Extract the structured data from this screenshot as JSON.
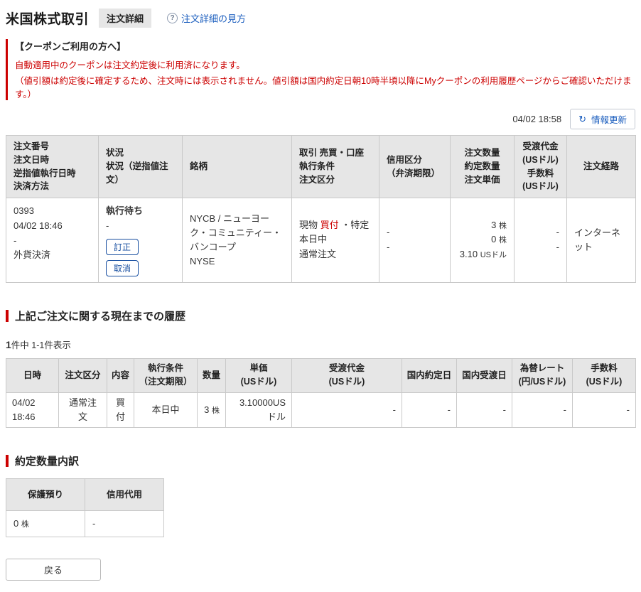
{
  "page": {
    "title": "米国株式取引",
    "badge": "注文詳細",
    "help_link": "注文詳細の見方"
  },
  "icons": {
    "help": "?",
    "refresh": "↻"
  },
  "coupon_notice": {
    "heading": "【クーポンご利用の方へ】",
    "line1": "自動適用中のクーポンは注文約定後に利用済になります。",
    "line2": "（値引額は約定後に確定するため、注文時には表示されません。値引額は国内約定日朝10時半頃以降にMyクーポンの利用履歴ページからご確認いただけます。）"
  },
  "toolbar": {
    "timestamp": "04/02 18:58",
    "refresh_label": "情報更新"
  },
  "order_table": {
    "headers": {
      "col1": "注文番号\n注文日時\n逆指値執行日時\n決済方法",
      "col2": "状況\n状況（逆指値注文）",
      "col3": "銘柄",
      "col4": "取引 売買・口座\n執行条件\n注文区分",
      "col5": "信用区分\n（弁済期限）",
      "col6": "注文数量\n約定数量\n注文単価",
      "col7": "受渡代金\n(USドル)\n手数料\n(USドル)",
      "col8": "注文経路"
    },
    "row": {
      "order_number": "0393",
      "order_datetime": "04/02 18:46",
      "stop_exec_datetime": "-",
      "settlement_method": "外貨決済",
      "status": "執行待ち",
      "status_stop": "-",
      "amend_label": "訂正",
      "cancel_label": "取消",
      "symbol_name": "NYCB / ニューヨーク・コミュニティー・バンコープ",
      "exchange": "NYSE",
      "trade_type": "現物",
      "trade_side": "買付",
      "account_type": "・特定",
      "exec_condition": "本日中",
      "order_type": "通常注文",
      "margin_type": "-",
      "margin_term": "-",
      "order_qty": "3",
      "order_qty_unit": "株",
      "filled_qty": "0",
      "filled_qty_unit": "株",
      "order_price": "3.10",
      "order_price_unit": "USドル",
      "settlement_amount": "-",
      "commission": "-",
      "order_route": "インターネット"
    }
  },
  "history_section": {
    "title": "上記ご注文に関する現在までの履歴",
    "count_bold": "1",
    "count_rest": "件中 1-1件表示",
    "headers": [
      "日時",
      "注文区分",
      "内容",
      "執行条件\n（注文期限）",
      "数量",
      "単価\n(USドル)",
      "受渡代金\n(USドル)",
      "国内約定日",
      "国内受渡日",
      "為替レート\n(円/USドル)",
      "手数料\n(USドル)"
    ],
    "row": {
      "datetime": "04/02 18:46",
      "order_type": "通常注文",
      "action": "買付",
      "exec_condition": "本日中",
      "qty": "3",
      "qty_unit": "株",
      "price": "3.10000USドル",
      "settlement_amount": "-",
      "domestic_contract_date": "-",
      "domestic_settlement_date": "-",
      "fx_rate": "-",
      "commission": "-"
    }
  },
  "breakdown_section": {
    "title": "約定数量内訳",
    "headers": [
      "保護預り",
      "信用代用"
    ],
    "row": {
      "protected_deposit": "0",
      "protected_deposit_unit": "株",
      "margin_substitute": "-"
    }
  },
  "footer": {
    "back_label": "戻る"
  },
  "colors": {
    "accent_red": "#cc0000",
    "link_blue": "#1a5dbe",
    "action_button_blue": "#174ea0",
    "table_header_bg": "#e6e6e6",
    "table_border": "#c9c9c9",
    "text": "#333333"
  }
}
